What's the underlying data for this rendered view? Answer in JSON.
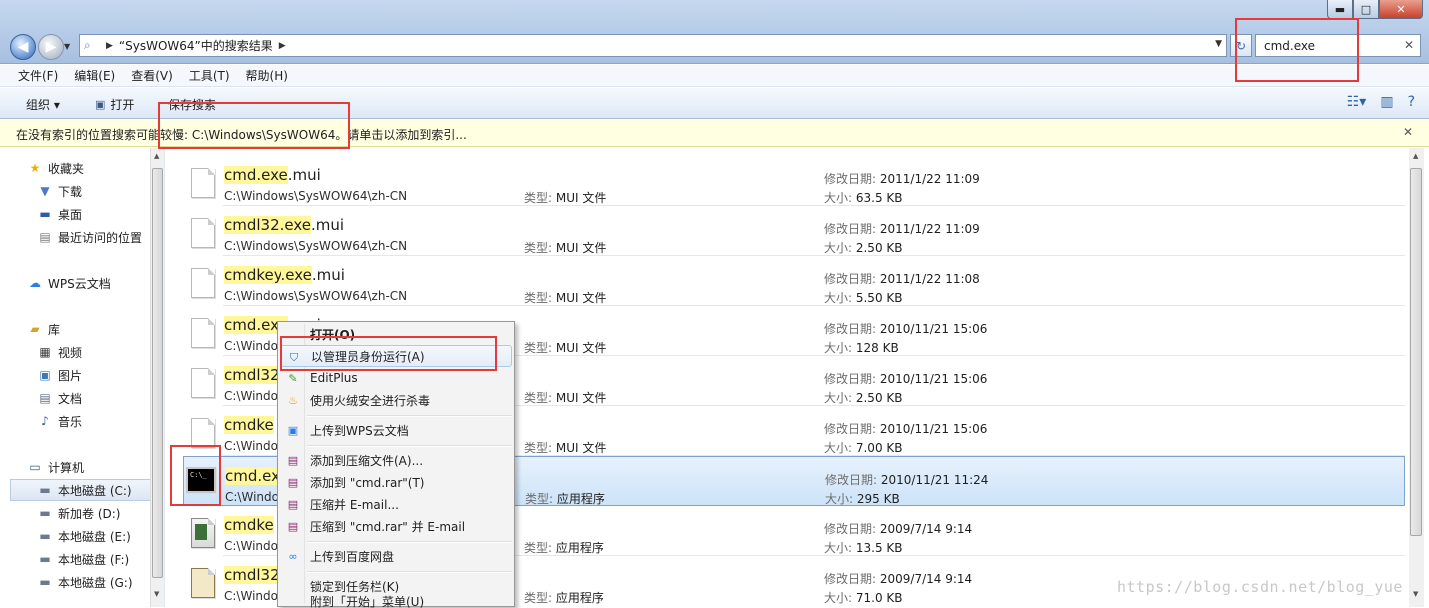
{
  "window": {
    "controls": {
      "minimize": "▬",
      "maximize": "□",
      "close": "✕"
    }
  },
  "address": {
    "back": "◀",
    "forward": "▶",
    "crumb": "“SysWOW64”中的搜索结果"
  },
  "search": {
    "value": "cmd.exe"
  },
  "menu": [
    "文件(F)",
    "编辑(E)",
    "查看(V)",
    "工具(T)",
    "帮助(H)"
  ],
  "commands": {
    "organize": "组织 ▾",
    "open": "打开",
    "save_search": "保存搜索"
  },
  "infobar": {
    "text": "在没有索引的位置搜索可能较慢: C:\\Windows\\SysWOW64。请单击以添加到索引..."
  },
  "nav": {
    "favorites": "收藏夹",
    "downloads": "下载",
    "desktop": "桌面",
    "recent": "最近访问的位置",
    "wps": "WPS云文档",
    "libraries": "库",
    "videos": "视频",
    "pictures": "图片",
    "documents": "文档",
    "music": "音乐",
    "computer": "计算机",
    "drive_c": "本地磁盘 (C:)",
    "drive_d": "新加卷 (D:)",
    "drive_e": "本地磁盘 (E:)",
    "drive_f": "本地磁盘 (F:)",
    "drive_g": "本地磁盘 (G:)"
  },
  "labels": {
    "type": "类型: ",
    "modified": "修改日期: ",
    "size": "大小: "
  },
  "files": [
    {
      "n1": "cmd.exe",
      "n2": "",
      "n3": ".mui",
      "path": "C:\\Windows\\SysWOW64\\zh-CN",
      "type": "MUI 文件",
      "date": "2011/1/22 11:09",
      "size": "63.5 KB"
    },
    {
      "n1": "cmdl32",
      "n2": ".exe",
      "n3": ".mui",
      "path": "C:\\Windows\\SysWOW64\\zh-CN",
      "type": "MUI 文件",
      "date": "2011/1/22 11:09",
      "size": "2.50 KB"
    },
    {
      "n1": "cmdkey",
      "n2": ".exe",
      "n3": ".mui",
      "path": "C:\\Windows\\SysWOW64\\zh-CN",
      "type": "MUI 文件",
      "date": "2011/1/22 11:08",
      "size": "5.50 KB"
    },
    {
      "n1": "cmd.exe",
      "n2": "",
      "n3": ".mui",
      "path": "C:\\Windo",
      "type": "MUI 文件",
      "date": "2010/11/21 15:06",
      "size": "128 KB"
    },
    {
      "n1": "cmdl32",
      "n2": "",
      "n3": "",
      "path": "C:\\Windo",
      "type": "MUI 文件",
      "date": "2010/11/21 15:06",
      "size": "2.50 KB"
    },
    {
      "n1": "cmdke",
      "n2": "",
      "n3": "",
      "path": "C:\\Windo",
      "type": "MUI 文件",
      "date": "2010/11/21 15:06",
      "size": "7.00 KB"
    },
    {
      "n1": "cmd.ex",
      "n2": "",
      "n3": "",
      "path": "C:\\Windo",
      "type": "应用程序",
      "date": "2010/11/21 11:24",
      "size": "295 KB"
    },
    {
      "n1": "cmdke",
      "n2": "",
      "n3": "",
      "path": "C:\\Windo",
      "type": "应用程序",
      "date": "2009/7/14 9:14",
      "size": "13.5 KB"
    },
    {
      "n1": "cmdl32",
      "n2": "",
      "n3": "",
      "path": "C:\\Windo",
      "type": "应用程序",
      "date": "2009/7/14 9:14",
      "size": "71.0 KB"
    }
  ],
  "context_menu": {
    "open": "打开(O)",
    "run_as_admin": "以管理员身份运行(A)",
    "editplus": "EditPlus",
    "scan": "使用火绒安全进行杀毒",
    "upload_wps": "上传到WPS云文档",
    "add_archive": "添加到压缩文件(A)...",
    "add_rar": "添加到 \"cmd.rar\"(T)",
    "compress_email": "压缩并 E-mail...",
    "compress_rar_email": "压缩到 \"cmd.rar\" 并 E-mail",
    "upload_baidu": "上传到百度网盘",
    "pin_taskbar": "锁定到任务栏(K)",
    "pin_start": "附到「开始」菜单(U)"
  },
  "watermark": "https://blog.csdn.net/blog_yue",
  "colors": {
    "highlight": "#fff799",
    "callout": "#e53a3a",
    "selection": "#cde3f8"
  }
}
